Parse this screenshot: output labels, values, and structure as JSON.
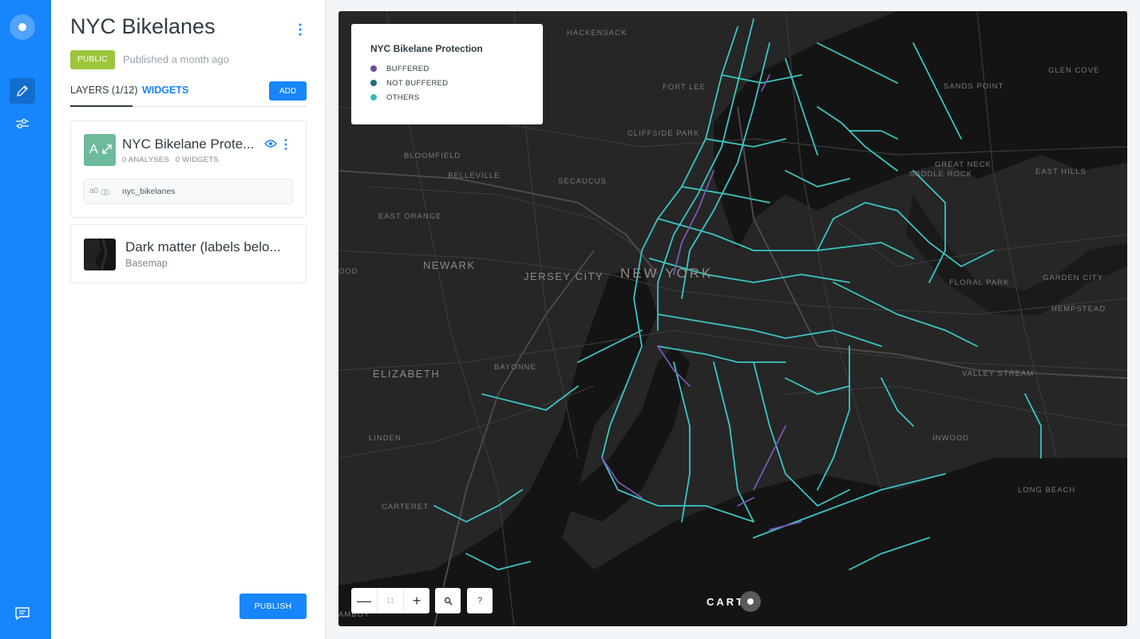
{
  "rail": {
    "icons": [
      "carto-logo-icon",
      "pencil-icon",
      "sliders-icon",
      "chat-icon"
    ]
  },
  "panel": {
    "title": "NYC Bikelanes",
    "privacy_badge": "PUBLIC",
    "published": "Published a month ago",
    "tabs": {
      "layers": "LAYERS (1/12)",
      "widgets": "WIDGETS"
    },
    "add_label": "ADD",
    "layer": {
      "letter": "A",
      "name": "NYC Bikelane Prote...",
      "analyses": "0 ANALYSES",
      "widgets": "0 WIDGETS",
      "source_id": "a0",
      "source_name": "nyc_bikelanes"
    },
    "basemap": {
      "name": "Dark matter (labels belo...",
      "subtitle": "Basemap"
    },
    "publish_label": "PUBLISH"
  },
  "map": {
    "legend": {
      "title": "NYC Bikelane Protection",
      "items": [
        {
          "label": "BUFFERED",
          "color": "#6b4e9e"
        },
        {
          "label": "NOT BUFFERED",
          "color": "#1f6c7d"
        },
        {
          "label": "OTHERS",
          "color": "#3bb8b5"
        }
      ]
    },
    "zoom_level": "11",
    "zoom_out": "—",
    "zoom_in": "+",
    "help": "?",
    "attribution": "CART",
    "colors": {
      "lane": "#3bc6c4",
      "buffered": "#7a57b3",
      "land": "#262626",
      "water": "#141414"
    },
    "places": {
      "hackensack": "HACKENSACK",
      "fort_lee": "FORT LEE",
      "cliffside_park": "CLIFFSIDE PARK",
      "bloomfield": "BLOOMFIELD",
      "belleville": "BELLEVILLE",
      "secaucus": "SECAUCUS",
      "east_orange": "EAST ORANGE",
      "newark": "NEWARK",
      "jersey_city": "JERSEY CITY",
      "new_york": "NEW YORK",
      "ood": "OOD",
      "elizabeth": "ELIZABETH",
      "bayonne": "BAYONNE",
      "linden": "LINDEN",
      "carteret": "CARTERET",
      "sands_point": "SANDS POINT",
      "glen_cove": "GLEN COVE",
      "great_neck": "GREAT NECK",
      "saddle_rock": "SADDLE ROCK",
      "east_hills": "EAST HILLS",
      "floral_park": "FLORAL PARK",
      "garden_city": "GARDEN CITY",
      "hempstead": "HEMPSTEAD",
      "valley_stream": "VALLEY STREAM",
      "inwood": "INWOOD",
      "long_beach": "LONG BEACH",
      "amboy": "AMBOY"
    }
  }
}
